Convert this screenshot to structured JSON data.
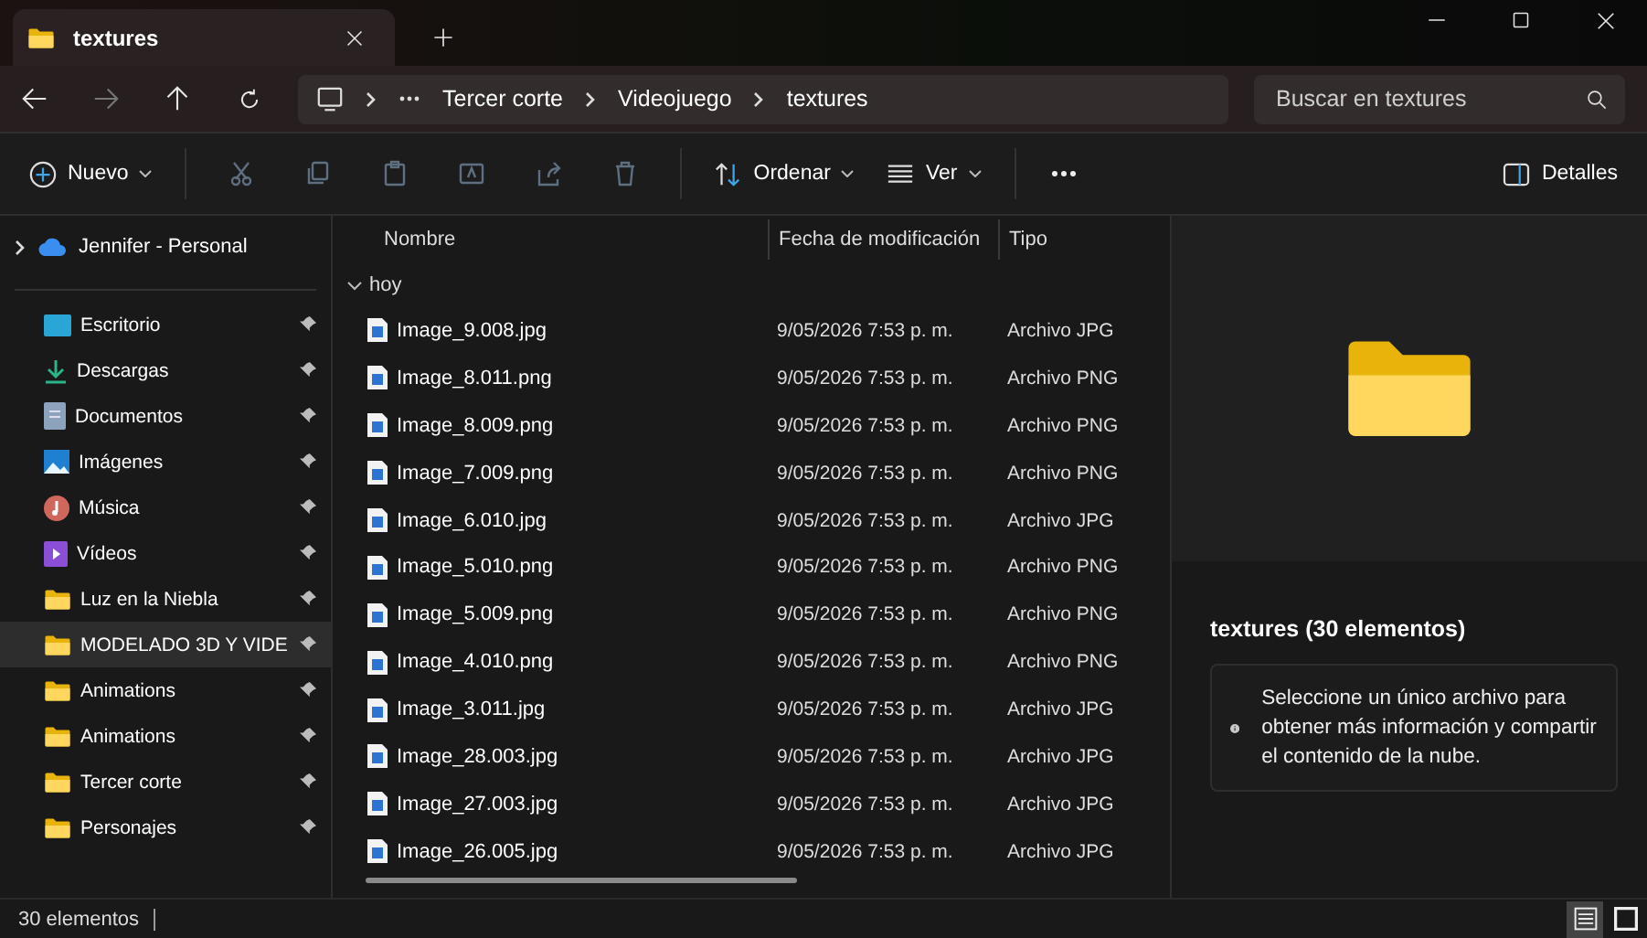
{
  "tab": {
    "title": "textures"
  },
  "address": {
    "crumbs": [
      "Tercer corte",
      "Videojuego",
      "textures"
    ]
  },
  "search": {
    "placeholder": "Buscar en textures"
  },
  "toolbar": {
    "new_label": "Nuevo",
    "sort_label": "Ordenar",
    "view_label": "Ver",
    "details_label": "Detalles"
  },
  "sidebar": {
    "account": "Jennifer - Personal",
    "items": [
      {
        "label": "Escritorio",
        "kind": "desktop",
        "selected": false
      },
      {
        "label": "Descargas",
        "kind": "download",
        "selected": false
      },
      {
        "label": "Documentos",
        "kind": "documents",
        "selected": false
      },
      {
        "label": "Imágenes",
        "kind": "pictures",
        "selected": false
      },
      {
        "label": "Música",
        "kind": "music",
        "selected": false
      },
      {
        "label": "Vídeos",
        "kind": "videos",
        "selected": false
      },
      {
        "label": "Luz en la Niebla",
        "kind": "folder",
        "selected": false
      },
      {
        "label": "MODELADO 3D Y VIDE",
        "kind": "folder",
        "selected": true
      },
      {
        "label": "Animations",
        "kind": "folder",
        "selected": false
      },
      {
        "label": "Animations",
        "kind": "folder",
        "selected": false
      },
      {
        "label": "Tercer corte",
        "kind": "folder",
        "selected": false
      },
      {
        "label": "Personajes",
        "kind": "folder",
        "selected": false
      }
    ]
  },
  "table": {
    "columns": [
      "Nombre",
      "Fecha de modificación",
      "Tipo"
    ],
    "group": "hoy",
    "rows": [
      {
        "name": "Image_9.008.jpg",
        "date": "9/05/2026 7:53 p. m.",
        "type": "Archivo JPG"
      },
      {
        "name": "Image_8.011.png",
        "date": "9/05/2026 7:53 p. m.",
        "type": "Archivo PNG"
      },
      {
        "name": "Image_8.009.png",
        "date": "9/05/2026 7:53 p. m.",
        "type": "Archivo PNG"
      },
      {
        "name": "Image_7.009.png",
        "date": "9/05/2026 7:53 p. m.",
        "type": "Archivo PNG"
      },
      {
        "name": "Image_6.010.jpg",
        "date": "9/05/2026 7:53 p. m.",
        "type": "Archivo JPG"
      },
      {
        "name": "Image_5.010.png",
        "date": "9/05/2026 7:53 p. m.",
        "type": "Archivo PNG"
      },
      {
        "name": "Image_5.009.png",
        "date": "9/05/2026 7:53 p. m.",
        "type": "Archivo PNG"
      },
      {
        "name": "Image_4.010.png",
        "date": "9/05/2026 7:53 p. m.",
        "type": "Archivo PNG"
      },
      {
        "name": "Image_3.011.jpg",
        "date": "9/05/2026 7:53 p. m.",
        "type": "Archivo JPG"
      },
      {
        "name": "Image_28.003.jpg",
        "date": "9/05/2026 7:53 p. m.",
        "type": "Archivo JPG"
      },
      {
        "name": "Image_27.003.jpg",
        "date": "9/05/2026 7:53 p. m.",
        "type": "Archivo JPG"
      },
      {
        "name": "Image_26.005.jpg",
        "date": "9/05/2026 7:53 p. m.",
        "type": "Archivo JPG"
      }
    ]
  },
  "details": {
    "title": "textures (30 elementos)",
    "info": "Seleccione un único archivo para obtener más información y compartir el contenido de la nube."
  },
  "status_bar": {
    "count": "30 elementos",
    "view_buttons": [
      {
        "kind": "details",
        "selected": true
      },
      {
        "kind": "tiles",
        "selected": false
      }
    ]
  }
}
